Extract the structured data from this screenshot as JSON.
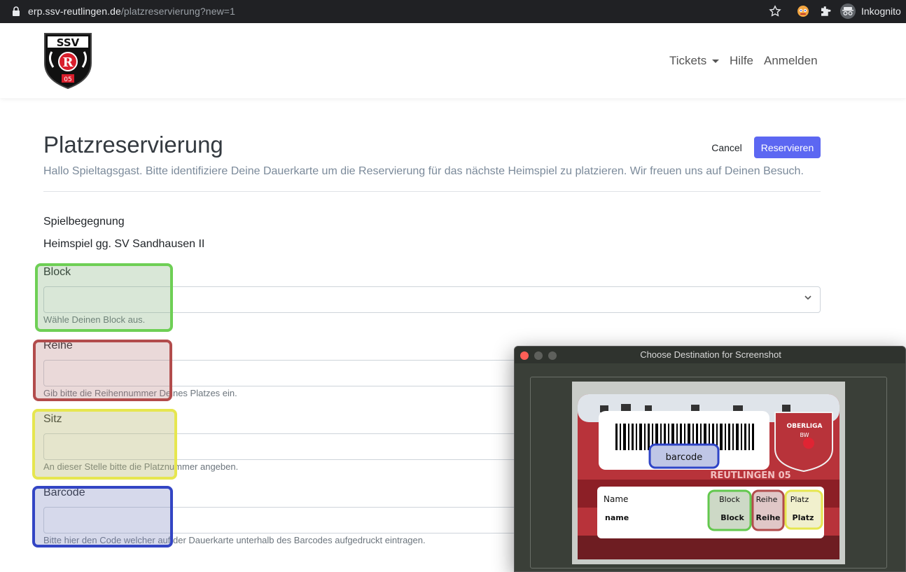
{
  "browser": {
    "url_host": "erp.ssv-reutlingen.de",
    "url_path": "/platzreservierung?new=1",
    "incognito_label": "Inkognito"
  },
  "header": {
    "logo_text": "SSV",
    "nav": {
      "tickets": "Tickets",
      "help": "Hilfe",
      "login": "Anmelden"
    }
  },
  "page": {
    "title": "Platzreservierung",
    "subtitle": "Hallo Spieltagsgast. Bitte identifiziere Deine Dauerkarte um die Reservierung für das nächste Heimspiel zu platzieren. Wir freuen uns auf Deinen Besuch.",
    "cancel_label": "Cancel",
    "reserve_label": "Reservieren",
    "match_label": "Spielbegegnung",
    "match_value": "Heimspiel gg. SV Sandhausen II"
  },
  "form": {
    "block": {
      "label": "Block",
      "hint": "Wähle Deinen Block aus."
    },
    "row": {
      "label": "Reihe",
      "hint": "Gib bitte die Reihennummer Deines Platzes ein."
    },
    "seat": {
      "label": "Sitz",
      "hint": "An dieser Stelle bitte die Platznummer angeben."
    },
    "barcode": {
      "label": "Barcode",
      "hint": "Bitte hier den Code welcher auf der Dauerkarte unterhalb des Barcodes aufgedruckt eintragen."
    }
  },
  "highlight_colors": {
    "block": "#6ecf55",
    "row": "#b24c4c",
    "seat": "#e6e64f",
    "barcode": "#3345c4"
  },
  "colors": {
    "primary": "#5c67f2"
  },
  "dialog": {
    "title": "Choose Destination for Screenshot",
    "card": {
      "barcode_label": "barcode",
      "league": "OBERLIGA",
      "league_sub": "BW",
      "club_banner": "REUTLINGEN 05",
      "name_header": "Name",
      "name_value": "name",
      "block_header": "Block",
      "block_value": "Block",
      "row_header": "Reihe",
      "row_value": "Reihe",
      "seat_header": "Platz",
      "seat_value": "Platz"
    }
  }
}
